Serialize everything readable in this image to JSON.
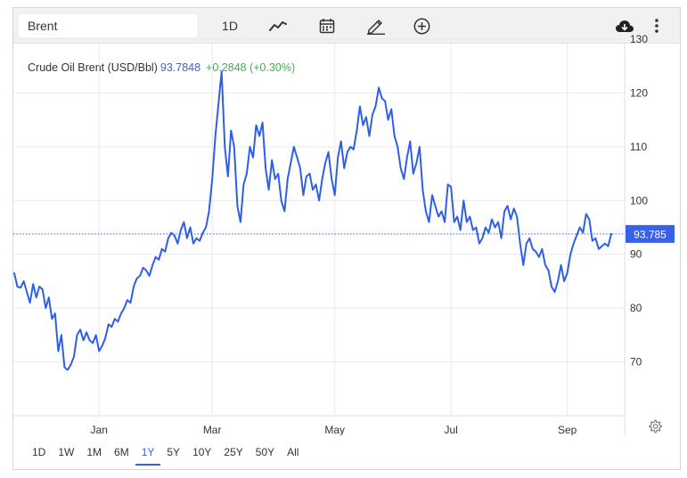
{
  "toolbar": {
    "symbol_value": "Brent",
    "interval_label": "1D",
    "icons": [
      "line-chart-icon",
      "calendar-icon",
      "pencil-icon",
      "plus-circle-icon",
      "cloud-download-icon",
      "more-vert-icon"
    ]
  },
  "header": {
    "name": "Crude Oil Brent (USD/Bbl)",
    "price": "93.7848",
    "change": "+0.2848 (+0.30%)"
  },
  "ranges": [
    "1D",
    "1W",
    "1M",
    "6M",
    "1Y",
    "5Y",
    "10Y",
    "25Y",
    "50Y",
    "All"
  ],
  "active_range": "1Y",
  "colors": {
    "line": "#2f5fe6",
    "accent": "#3860e8",
    "positive": "#3bb54a",
    "grid": "#e9e9e9"
  },
  "chart_data": {
    "type": "line",
    "title": "",
    "xlabel": "",
    "ylabel": "",
    "ylim": [
      60,
      130
    ],
    "yticks": [
      70,
      80,
      90,
      100,
      110,
      120,
      130
    ],
    "xtick_labels": [
      "Jan",
      "Mar",
      "May",
      "Jul",
      "Sep"
    ],
    "grid": true,
    "last_value_label": "93.785",
    "last_value": 93.785,
    "series": [
      {
        "values": [
          86.5,
          84.0,
          83.8,
          85.0,
          83.0,
          81.0,
          84.5,
          82.0,
          84.0,
          83.5,
          80.0,
          82.0,
          78.0,
          79.0,
          72.0,
          75.0,
          69.0,
          68.5,
          69.5,
          71.0,
          75.0,
          76.0,
          74.0,
          75.5,
          74.0,
          73.5,
          75.0,
          72.0,
          73.0,
          74.5,
          77.0,
          76.5,
          78.0,
          77.5,
          79.0,
          80.0,
          81.5,
          81.0,
          84.0,
          85.5,
          86.0,
          87.5,
          87.0,
          86.0,
          88.0,
          89.5,
          89.0,
          91.0,
          90.5,
          93.0,
          94.0,
          93.5,
          92.0,
          94.5,
          96.0,
          93.0,
          95.0,
          92.0,
          93.0,
          92.5,
          94.0,
          95.0,
          98.0,
          104.0,
          112.0,
          118.0,
          124.0,
          110.0,
          104.5,
          113.0,
          110.0,
          99.0,
          96.0,
          103.0,
          105.0,
          110.0,
          108.0,
          114.0,
          112.0,
          114.5,
          106.0,
          102.0,
          107.5,
          104.0,
          105.0,
          100.0,
          98.0,
          104.0,
          107.0,
          110.0,
          108.0,
          106.0,
          101.0,
          104.5,
          105.0,
          102.0,
          103.0,
          100.0,
          104.0,
          107.0,
          109.0,
          104.0,
          101.0,
          108.0,
          111.0,
          106.0,
          109.0,
          110.0,
          109.5,
          113.0,
          117.5,
          114.0,
          115.5,
          112.0,
          116.0,
          117.5,
          121.0,
          119.0,
          118.5,
          115.0,
          117.0,
          112.0,
          110.0,
          106.0,
          104.0,
          108.0,
          111.0,
          105.0,
          107.0,
          110.0,
          102.0,
          98.0,
          96.0,
          101.0,
          99.0,
          97.0,
          98.0,
          96.0,
          103.0,
          102.5,
          96.0,
          97.0,
          94.5,
          100.0,
          96.0,
          97.0,
          94.5,
          95.0,
          92.0,
          93.0,
          95.0,
          94.0,
          96.5,
          95.0,
          96.0,
          93.0,
          98.0,
          99.0,
          96.5,
          98.5,
          97.0,
          92.0,
          88.0,
          92.0,
          93.0,
          91.0,
          90.5,
          89.5,
          91.0,
          88.0,
          87.0,
          84.0,
          83.0,
          85.0,
          88.0,
          85.0,
          86.5,
          90.0,
          92.0,
          93.5,
          95.0,
          94.0,
          97.5,
          96.5,
          92.5,
          93.0,
          91.0,
          91.5,
          92.0,
          91.5,
          93.785
        ]
      }
    ]
  }
}
